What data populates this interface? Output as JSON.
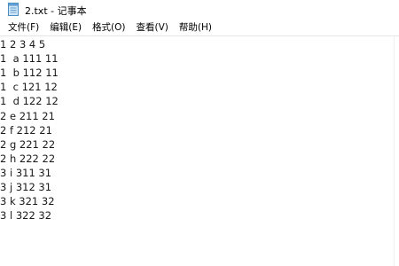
{
  "window": {
    "title": "2.txt - 记事本",
    "app_icon": "notepad-icon"
  },
  "menu": {
    "items": [
      {
        "label": "文件(F)"
      },
      {
        "label": "编辑(E)"
      },
      {
        "label": "格式(O)"
      },
      {
        "label": "查看(V)"
      },
      {
        "label": "帮助(H)"
      }
    ]
  },
  "document": {
    "lines": [
      "1 2 3 4 5",
      "1  a 111 11",
      "1  b 112 11",
      "1  c 121 12",
      "1  d 122 12",
      "2 e 211 21",
      "2 f 212 21",
      "2 g 221 22",
      "2 h 222 22",
      "3 i 311 31",
      "3 j 312 31",
      "3 k 321 32",
      "3 l 322 32"
    ]
  },
  "colors": {
    "background": "#ffffff",
    "text": "#1a1a1a",
    "separator": "#e6e6e6"
  }
}
